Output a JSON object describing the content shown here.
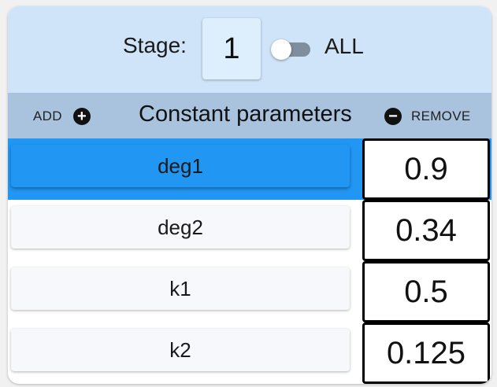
{
  "stage": {
    "label": "Stage:",
    "value": "1",
    "toggle_on": false,
    "all_label": "ALL"
  },
  "params_header": {
    "add_label": "ADD",
    "add_icon": "plus-circle-icon",
    "title": "Constant parameters",
    "remove_label": "REMOVE",
    "remove_icon": "minus-circle-icon"
  },
  "parameters": [
    {
      "name": "deg1",
      "value": "0.9",
      "selected": true
    },
    {
      "name": "deg2",
      "value": "0.34",
      "selected": false
    },
    {
      "name": "k1",
      "value": "0.5",
      "selected": false
    },
    {
      "name": "k2",
      "value": "0.125",
      "selected": false
    }
  ],
  "colors": {
    "stage_bar": "#cfe4f8",
    "param_bar": "#a9c3de",
    "selected_row": "#2196f3"
  }
}
